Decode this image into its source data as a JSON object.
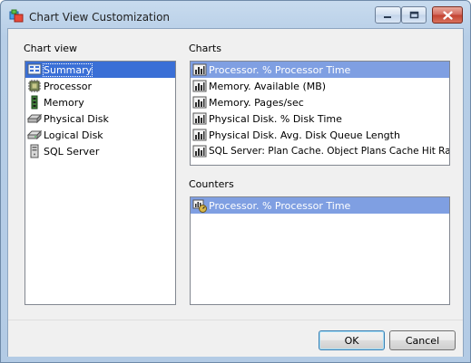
{
  "window": {
    "title": "Chart View Customization"
  },
  "chart_view": {
    "label": "Chart view",
    "items": [
      {
        "label": "Summary",
        "icon": "summary-chart-icon",
        "selected": true
      },
      {
        "label": "Processor",
        "icon": "processor-chip-icon",
        "selected": false
      },
      {
        "label": "Memory",
        "icon": "memory-module-icon",
        "selected": false
      },
      {
        "label": "Physical Disk",
        "icon": "physical-disk-icon",
        "selected": false
      },
      {
        "label": "Logical Disk",
        "icon": "logical-disk-icon",
        "selected": false
      },
      {
        "label": "SQL Server",
        "icon": "database-server-icon",
        "selected": false
      }
    ]
  },
  "charts": {
    "label": "Charts",
    "items": [
      {
        "label": "Processor. % Processor Time",
        "icon": "bar-chart-icon",
        "selected": true
      },
      {
        "label": "Memory. Available (MB)",
        "icon": "bar-chart-icon",
        "selected": false
      },
      {
        "label": "Memory. Pages/sec",
        "icon": "bar-chart-icon",
        "selected": false
      },
      {
        "label": "Physical Disk. % Disk Time",
        "icon": "bar-chart-icon",
        "selected": false
      },
      {
        "label": "Physical Disk. Avg. Disk Queue Length",
        "icon": "bar-chart-icon",
        "selected": false
      },
      {
        "label": "SQL Server: Plan Cache. Object Plans Cache Hit Ratio",
        "icon": "bar-chart-icon",
        "selected": false
      }
    ]
  },
  "counters": {
    "label": "Counters",
    "items": [
      {
        "label": "Processor. % Processor Time",
        "icon": "counter-gauge-icon",
        "selected": true
      }
    ]
  },
  "buttons": {
    "ok": "OK",
    "cancel": "Cancel"
  },
  "colors": {
    "selection": "#3a6fd6",
    "selection_inactive": "#7f9fe2",
    "title_bar": "#b9d1ea",
    "close_button": "#c94a36"
  }
}
